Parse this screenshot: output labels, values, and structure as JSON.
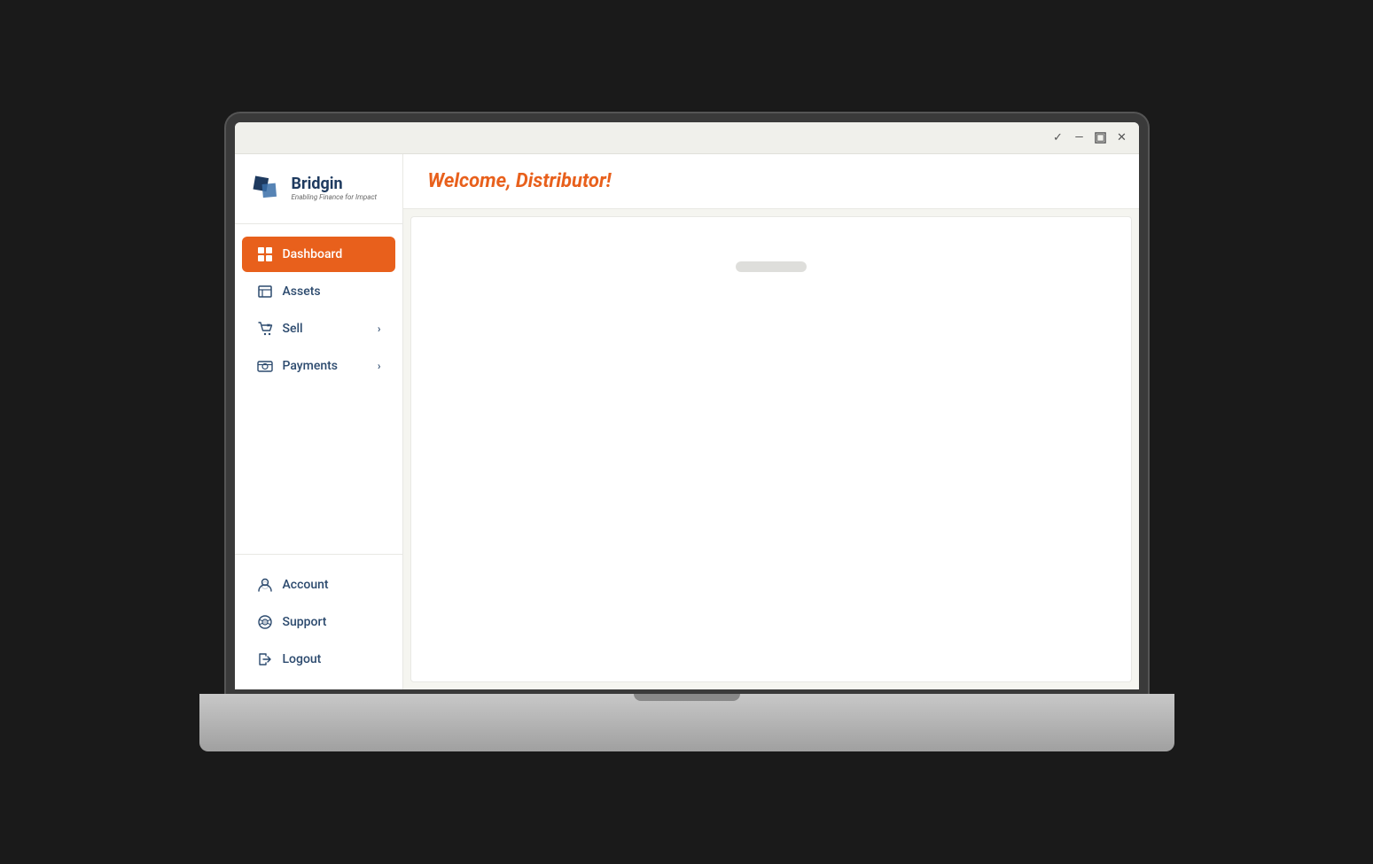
{
  "window": {
    "titlebar_controls": [
      "check-icon",
      "minimize-icon",
      "maximize-icon",
      "close-icon"
    ]
  },
  "sidebar": {
    "logo": {
      "name": "Bridgin",
      "tagline": "Enabling Finance for Impact"
    },
    "nav_items": [
      {
        "id": "dashboard",
        "label": "Dashboard",
        "active": true,
        "has_chevron": false
      },
      {
        "id": "assets",
        "label": "Assets",
        "active": false,
        "has_chevron": false
      },
      {
        "id": "sell",
        "label": "Sell",
        "active": false,
        "has_chevron": true
      },
      {
        "id": "payments",
        "label": "Payments",
        "active": false,
        "has_chevron": true
      }
    ],
    "bottom_items": [
      {
        "id": "account",
        "label": "Account"
      },
      {
        "id": "support",
        "label": "Support"
      },
      {
        "id": "logout",
        "label": "Logout"
      }
    ]
  },
  "main": {
    "welcome_message": "Welcome, Distributor!"
  }
}
